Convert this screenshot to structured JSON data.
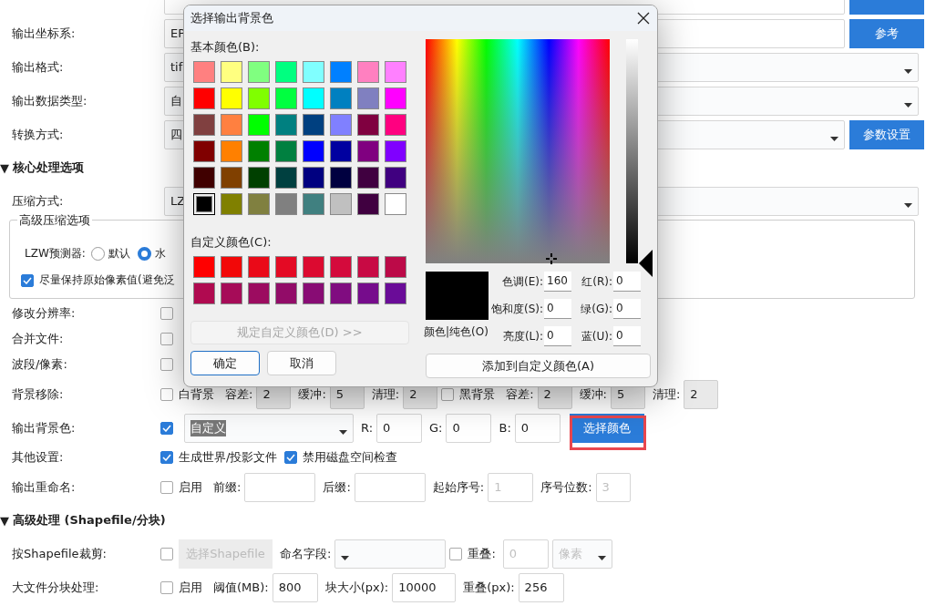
{
  "form": {
    "rows": [
      {
        "kind": "row",
        "controls": [
          {
            "kind": "path_field"
          },
          {
            "kind": "button",
            "disabled": false
          }
        ]
      },
      {
        "kind": "row",
        "label": "输出坐标系:",
        "controls": [
          {
            "kind": "path_field",
            "value": "EP"
          },
          {
            "kind": "button",
            "label": "参考",
            "disabled": false
          }
        ]
      },
      {
        "kind": "row",
        "label": "输出格式:",
        "controls": [
          {
            "kind": "dropdown",
            "value": "tif"
          }
        ]
      },
      {
        "kind": "row",
        "label": "输出数据类型:",
        "controls": [
          {
            "kind": "dropdown",
            "value": "自"
          }
        ]
      },
      {
        "kind": "row",
        "label": "转换方式:",
        "controls": [
          {
            "kind": "path_dropdown",
            "value": "四"
          },
          {
            "kind": "button",
            "label": "参数设置",
            "disabled": false
          }
        ]
      },
      {
        "kind": "section",
        "marker": "▼",
        "title": "核心处理选项"
      },
      {
        "kind": "row",
        "label": "压缩方式:",
        "controls": [
          {
            "kind": "dropdown",
            "value": "LZ"
          }
        ]
      },
      {
        "kind": "group",
        "title": "高级压缩选项",
        "lines": [
          {
            "controls": [
              {
                "kind": "text",
                "label": "LZW预测器:"
              },
              {
                "kind": "radio",
                "label": "默认",
                "selected": false
              },
              {
                "kind": "radio",
                "label": "水",
                "selected": true
              }
            ]
          },
          {
            "controls": [
              {
                "kind": "checkbox",
                "label": "尽量保持原始像素值(避免泛",
                "checked": true
              }
            ]
          }
        ]
      },
      {
        "kind": "row",
        "label": "修改分辨率:",
        "controls": [
          {
            "kind": "checkbox",
            "checked": false
          }
        ]
      },
      {
        "kind": "row",
        "label": "合并文件:",
        "controls": [
          {
            "kind": "checkbox",
            "checked": false
          }
        ]
      },
      {
        "kind": "row",
        "label": "波段/像素:",
        "controls": [
          {
            "kind": "checkbox",
            "checked": false
          }
        ]
      },
      {
        "kind": "row",
        "label": "背景移除:",
        "controls": [
          {
            "kind": "checkbox",
            "label": "白背景",
            "checked": false
          },
          {
            "kind": "text",
            "label": "容差:"
          },
          {
            "kind": "number_field",
            "value": "2",
            "disabled": true
          },
          {
            "kind": "text",
            "label": "缓冲:"
          },
          {
            "kind": "number_field",
            "value": "5",
            "disabled": true
          },
          {
            "kind": "text",
            "label": "清理:"
          },
          {
            "kind": "number_field",
            "value": "2",
            "disabled": true
          },
          {
            "kind": "checkbox",
            "label": "黑背景",
            "checked": false
          },
          {
            "kind": "text",
            "label": "容差:"
          },
          {
            "kind": "number_field",
            "value": "2",
            "disabled": true
          },
          {
            "kind": "text",
            "label": "缓冲:"
          },
          {
            "kind": "number_field",
            "value": "5",
            "disabled": true
          },
          {
            "kind": "text",
            "label": "清理:"
          },
          {
            "kind": "number_field",
            "value": "2",
            "disabled": true
          }
        ]
      },
      {
        "kind": "row",
        "label": "输出背景色:",
        "controls": [
          {
            "kind": "checkbox",
            "checked": true
          },
          {
            "kind": "combo",
            "value": "自定义",
            "text_selected": true
          },
          {
            "kind": "text",
            "label": "R:"
          },
          {
            "kind": "value_field",
            "value": "0",
            "disabled": false
          },
          {
            "kind": "text",
            "label": "G:"
          },
          {
            "kind": "value_field",
            "value": "0",
            "disabled": false
          },
          {
            "kind": "text",
            "label": "B:"
          },
          {
            "kind": "value_field",
            "value": "0",
            "disabled": false
          },
          {
            "kind": "button",
            "label": "选择颜色",
            "disabled": false,
            "highlighted": true
          }
        ]
      },
      {
        "kind": "row",
        "label": "其他设置:",
        "controls": [
          {
            "kind": "checkbox",
            "label": "生成世界/投影文件",
            "checked": true
          },
          {
            "kind": "checkbox",
            "label": "禁用磁盘空间检查",
            "checked": true
          }
        ]
      },
      {
        "kind": "row",
        "label": "输出重命名:",
        "controls": [
          {
            "kind": "checkbox",
            "label": "启用",
            "checked": false
          },
          {
            "kind": "text",
            "label": "前缀:"
          },
          {
            "kind": "name_field",
            "disabled": false
          },
          {
            "kind": "text",
            "label": "后缀:"
          },
          {
            "kind": "name_field",
            "disabled": false
          },
          {
            "kind": "text",
            "label": "起始序号:"
          },
          {
            "kind": "value_field",
            "placeholder": "1",
            "disabled": false
          },
          {
            "kind": "text",
            "label": "序号位数:"
          },
          {
            "kind": "number_field",
            "placeholder": "3",
            "disabled": false
          }
        ]
      },
      {
        "kind": "section",
        "marker": "▼",
        "title": "高级处理 (Shapefile/分块)"
      },
      {
        "kind": "row",
        "label": "按Shapefile裁剪:",
        "controls": [
          {
            "kind": "checkbox",
            "checked": false
          },
          {
            "kind": "button",
            "label": "选择Shapefile",
            "disabled": true
          },
          {
            "kind": "text",
            "label": "命名字段:"
          },
          {
            "kind": "field_combo"
          },
          {
            "kind": "checkbox",
            "label": "重叠:",
            "checked": false
          },
          {
            "kind": "value_field",
            "placeholder": "0",
            "disabled": false
          },
          {
            "kind": "unit_select",
            "placeholder": "像素"
          }
        ]
      },
      {
        "kind": "row",
        "label": "大文件分块处理:",
        "controls": [
          {
            "kind": "checkbox",
            "label": "启用",
            "checked": false
          },
          {
            "kind": "text",
            "label": "阈值(MB):"
          },
          {
            "kind": "value_field",
            "value": "800",
            "disabled": false
          },
          {
            "kind": "text",
            "label": "块大小(px):"
          },
          {
            "kind": "wide_field",
            "value": "10000",
            "disabled": false
          },
          {
            "kind": "text",
            "label": "重叠(px):"
          },
          {
            "kind": "value_field",
            "value": "256",
            "disabled": false
          }
        ]
      }
    ]
  },
  "dialog": {
    "title": "选择输出背景色",
    "basic_colors_label": "基本颜色(B):",
    "basic_colors": [
      {
        "color": "#ff8080",
        "selected": false
      },
      {
        "color": "#ffff80",
        "selected": false
      },
      {
        "color": "#80ff80",
        "selected": false
      },
      {
        "color": "#00ff80",
        "selected": false
      },
      {
        "color": "#80ffff",
        "selected": false
      },
      {
        "color": "#0080ff",
        "selected": false
      },
      {
        "color": "#ff80c0",
        "selected": false
      },
      {
        "color": "#ff80ff",
        "selected": false
      },
      {
        "color": "#ff0000",
        "selected": false
      },
      {
        "color": "#ffff00",
        "selected": false
      },
      {
        "color": "#80ff00",
        "selected": false
      },
      {
        "color": "#00ff40",
        "selected": false
      },
      {
        "color": "#00ffff",
        "selected": false
      },
      {
        "color": "#0080c0",
        "selected": false
      },
      {
        "color": "#8080c0",
        "selected": false
      },
      {
        "color": "#ff00ff",
        "selected": false
      },
      {
        "color": "#804040",
        "selected": false
      },
      {
        "color": "#ff8040",
        "selected": false
      },
      {
        "color": "#00ff00",
        "selected": false
      },
      {
        "color": "#008080",
        "selected": false
      },
      {
        "color": "#004080",
        "selected": false
      },
      {
        "color": "#8080ff",
        "selected": false
      },
      {
        "color": "#800040",
        "selected": false
      },
      {
        "color": "#ff0080",
        "selected": false
      },
      {
        "color": "#800000",
        "selected": false
      },
      {
        "color": "#ff8000",
        "selected": false
      },
      {
        "color": "#008000",
        "selected": false
      },
      {
        "color": "#008040",
        "selected": false
      },
      {
        "color": "#0000ff",
        "selected": false
      },
      {
        "color": "#0000a0",
        "selected": false
      },
      {
        "color": "#800080",
        "selected": false
      },
      {
        "color": "#8000ff",
        "selected": false
      },
      {
        "color": "#400000",
        "selected": false
      },
      {
        "color": "#804000",
        "selected": false
      },
      {
        "color": "#004000",
        "selected": false
      },
      {
        "color": "#004040",
        "selected": false
      },
      {
        "color": "#000080",
        "selected": false
      },
      {
        "color": "#000040",
        "selected": false
      },
      {
        "color": "#400040",
        "selected": false
      },
      {
        "color": "#400080",
        "selected": false
      },
      {
        "color": "#000000",
        "selected": true
      },
      {
        "color": "#808000",
        "selected": false
      },
      {
        "color": "#808040",
        "selected": false
      },
      {
        "color": "#808080",
        "selected": false
      },
      {
        "color": "#408080",
        "selected": false
      },
      {
        "color": "#c0c0c0",
        "selected": false
      },
      {
        "color": "#400040",
        "selected": false
      },
      {
        "color": "#ffffff",
        "selected": false
      }
    ],
    "custom_colors_label": "自定义颜色(C):",
    "custom_colors": [
      {
        "color": "#ff0000"
      },
      {
        "color": "#f20808"
      },
      {
        "color": "#ea0a18"
      },
      {
        "color": "#e40a24"
      },
      {
        "color": "#dc0a30"
      },
      {
        "color": "#d40a3c"
      },
      {
        "color": "#c80a44"
      },
      {
        "color": "#bc0a48"
      },
      {
        "color": "#b00a50"
      },
      {
        "color": "#a60c58"
      },
      {
        "color": "#9c0c60"
      },
      {
        "color": "#920c68"
      },
      {
        "color": "#880c74"
      },
      {
        "color": "#800c80"
      },
      {
        "color": "#760c8c"
      },
      {
        "color": "#6a0c98"
      }
    ],
    "define_button": {
      "label": "规定自定义颜色(D) >>",
      "disabled": true
    },
    "ok_button": "确定",
    "cancel_button": "取消",
    "luminance_slider": {
      "level": 0
    },
    "preview_label": "颜色|纯色(O)",
    "hsl_fields": [
      {
        "label": "色调(E):",
        "value": "160"
      },
      {
        "label": "饱和度(S):",
        "value": "0"
      },
      {
        "label": "亮度(L):",
        "value": "0"
      }
    ],
    "rgb_fields": [
      {
        "label": "红(R):",
        "value": "0"
      },
      {
        "label": "绿(G):",
        "value": "0"
      },
      {
        "label": "蓝(U):",
        "value": "0"
      }
    ],
    "add_button": "添加到自定义颜色(A)"
  }
}
